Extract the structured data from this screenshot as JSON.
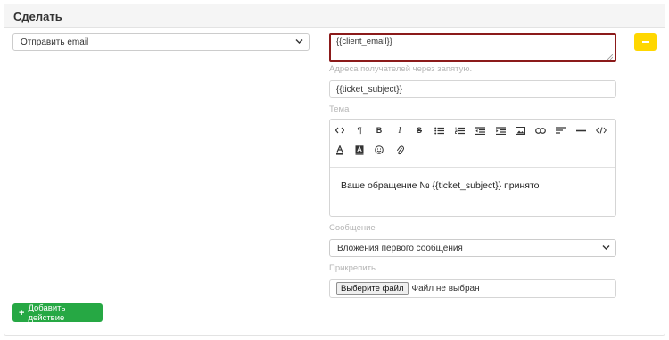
{
  "panel": {
    "title": "Сделать"
  },
  "action": {
    "selected": "Отправить email"
  },
  "recipients": {
    "value": "{{client_email}}",
    "hint": "Адреса получателей через запятую."
  },
  "subject": {
    "value": "{{ticket_subject}}",
    "hint": "Тема"
  },
  "editor": {
    "toolbar": [
      {
        "name": "code-view",
        "glyph": "<>"
      },
      {
        "name": "paragraph",
        "glyph": "¶"
      },
      {
        "name": "bold",
        "glyph": "B"
      },
      {
        "name": "italic",
        "glyph": "I"
      },
      {
        "name": "strikethrough",
        "glyph": "S"
      },
      {
        "name": "bullet-list",
        "glyph": "•≡"
      },
      {
        "name": "numbered-list",
        "glyph": "1≡"
      },
      {
        "name": "outdent",
        "glyph": "⇤"
      },
      {
        "name": "indent",
        "glyph": "⇥"
      },
      {
        "name": "image",
        "glyph": "▭"
      },
      {
        "name": "link",
        "glyph": "∞"
      },
      {
        "name": "align",
        "glyph": "≡"
      },
      {
        "name": "horizontal-rule",
        "glyph": "—"
      },
      {
        "name": "html-code",
        "glyph": "</>"
      },
      {
        "name": "text-color",
        "glyph": "A"
      },
      {
        "name": "background-color",
        "glyph": "A"
      },
      {
        "name": "emoji",
        "glyph": "☺"
      },
      {
        "name": "attachment",
        "glyph": "📎"
      }
    ],
    "body": "Ваше обращение № {{ticket_subject}} принято",
    "hint": "Сообщение"
  },
  "attach": {
    "selected": "Вложения первого сообщения",
    "hint": "Прикрепить"
  },
  "file": {
    "button": "Выберите файл",
    "status": "Файл не выбран"
  },
  "add_action": {
    "label": "Добавить действие"
  },
  "colors": {
    "remove_button": "#ffd700",
    "add_button": "#26a844",
    "email_border": "#8b1a1a"
  }
}
